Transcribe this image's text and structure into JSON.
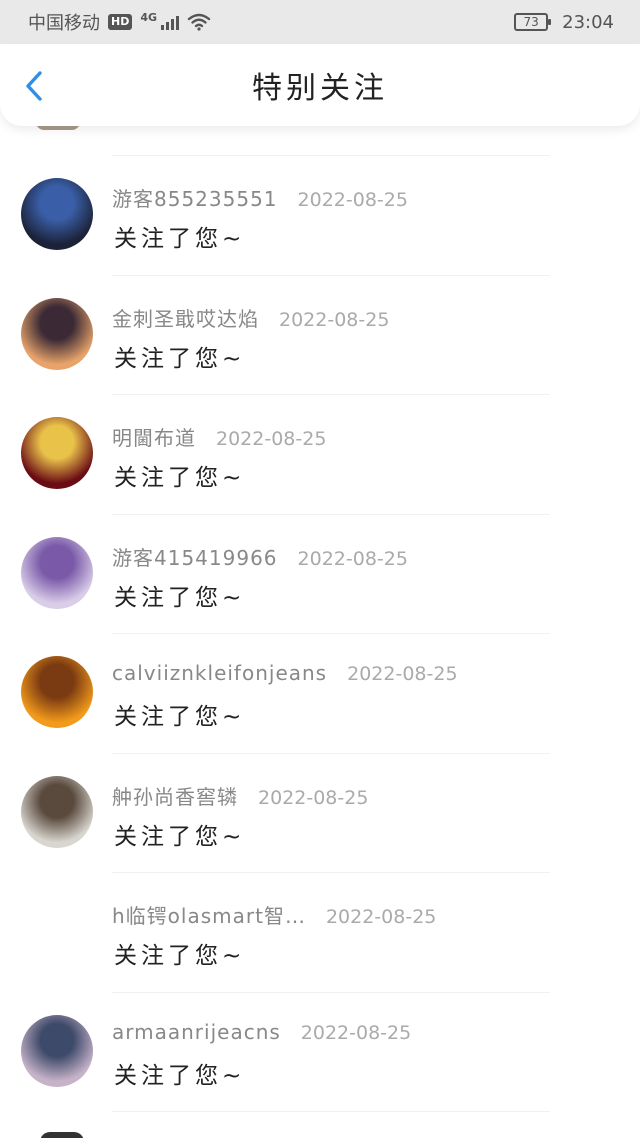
{
  "status_bar": {
    "carrier": "中国移动",
    "hd": "HD",
    "network": "4G",
    "battery": "73",
    "time": "23:04"
  },
  "header": {
    "title": "特别关注",
    "back_icon": "chevron-left-icon"
  },
  "items": [
    {
      "name": "游客855235551",
      "date": "2022-08-25",
      "message": "关注了您~",
      "avatar_colors": [
        "#1c2238",
        "#3a5fa8"
      ]
    },
    {
      "name": "金刺圣戢哎达焰",
      "date": "2022-08-25",
      "message": "关注了您~",
      "avatar_colors": [
        "#e7a36a",
        "#3b2a36"
      ]
    },
    {
      "name": "明閫布道",
      "date": "2022-08-25",
      "message": "关注了您~",
      "avatar_colors": [
        "#6b0c15",
        "#e9c24a"
      ]
    },
    {
      "name": "游客415419966",
      "date": "2022-08-25",
      "message": "关注了您~",
      "avatar_colors": [
        "#d9cde8",
        "#7a5aa8"
      ]
    },
    {
      "name": "calviiznkleifonjeans",
      "date": "2022-08-25",
      "message": "关注了您~",
      "avatar_colors": [
        "#f29a1c",
        "#7a3a12"
      ]
    },
    {
      "name": "舯孙尚香窖辚",
      "date": "2022-08-25",
      "message": "关注了您~",
      "avatar_colors": [
        "#d8d6cf",
        "#5a4a3e"
      ]
    },
    {
      "name": "h临锷olasmart智…",
      "date": "2022-08-25",
      "message": "关注了您~",
      "avatar_colors": []
    },
    {
      "name": "armaanrijeacns",
      "date": "2022-08-25",
      "message": "关注了您~",
      "avatar_colors": [
        "#c7b3c9",
        "#3e4a6a"
      ]
    }
  ],
  "colors": {
    "accent": "#2f8ee8",
    "name_text": "#888888",
    "date_text": "#aaaaaa",
    "message_text": "#222222"
  }
}
